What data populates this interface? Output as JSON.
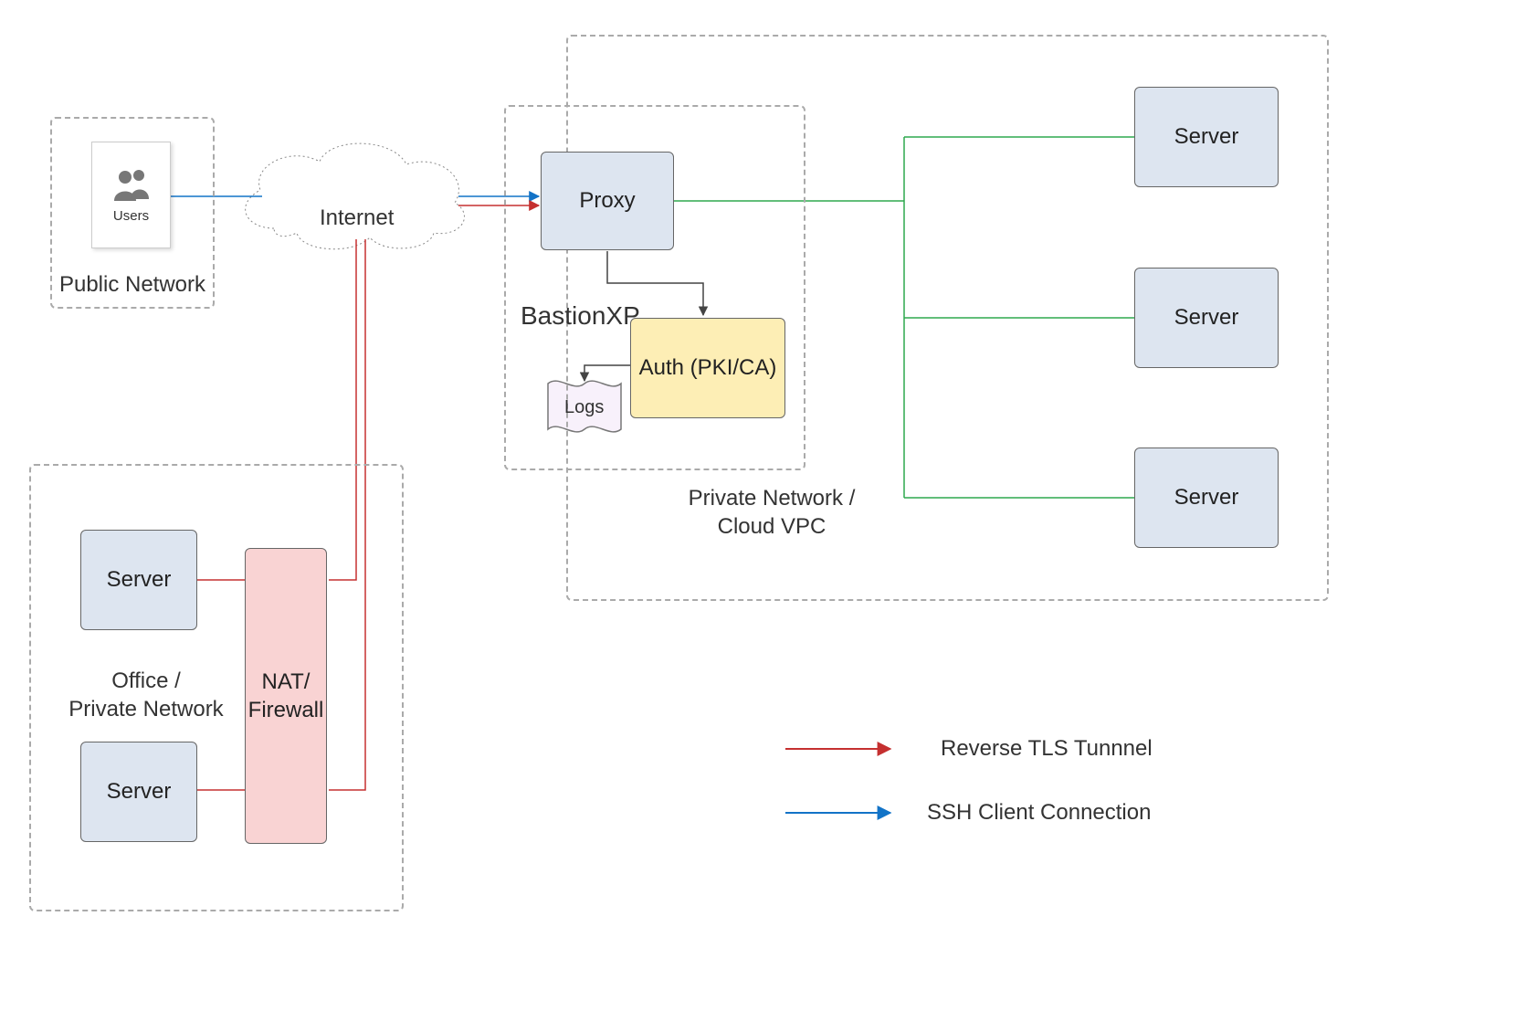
{
  "publicNetwork": {
    "title": "Public Network",
    "users": "Users"
  },
  "internet": "Internet",
  "bastion": {
    "title": "BastionXP",
    "proxy": "Proxy",
    "auth": "Auth (PKI/CA)",
    "logs": "Logs"
  },
  "privateVpc": {
    "title": "Private Network /\nCloud VPC",
    "server1": "Server",
    "server2": "Server",
    "server3": "Server"
  },
  "office": {
    "title": "Office /\nPrivate Network",
    "server1": "Server",
    "server2": "Server",
    "nat": "NAT/\nFirewall"
  },
  "legend": {
    "reverse": "Reverse TLS Tunnnel",
    "ssh": "SSH Client Connection"
  },
  "colors": {
    "blueFill": "#dde5f0",
    "yellowFill": "#fdeeb5",
    "pinkFill": "#f9d3d3",
    "lavFill": "#f8f1fb",
    "red": "#c53030",
    "blue": "#1273c7",
    "green": "#2fa84f"
  }
}
